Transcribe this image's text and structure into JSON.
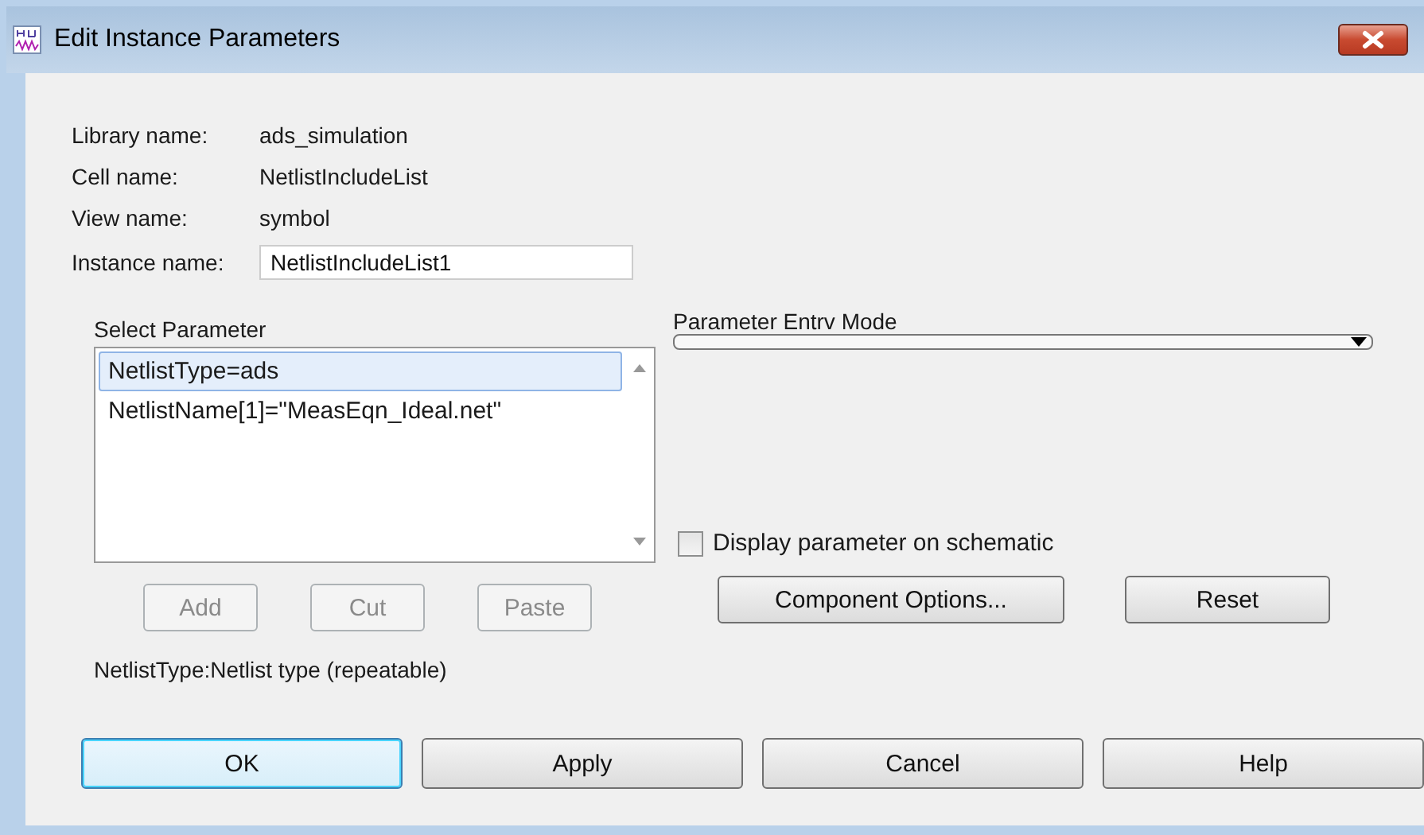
{
  "window": {
    "title": "Edit Instance Parameters"
  },
  "info": [
    {
      "label": "Library name:",
      "value": "ads_simulation"
    },
    {
      "label": "Cell name:",
      "value": "NetlistIncludeList"
    },
    {
      "label": "View name:",
      "value": "symbol"
    }
  ],
  "instance_name": {
    "label": "Instance name:",
    "value": "NetlistIncludeList1"
  },
  "select_parameter": {
    "label": "Select Parameter",
    "items": [
      {
        "text": "NetlistType=ads",
        "selected": true
      },
      {
        "text": "NetlistName[1]=\"MeasEqn_Ideal.net\"",
        "selected": false
      }
    ]
  },
  "list_buttons": [
    {
      "label": "Add",
      "disabled": true
    },
    {
      "label": "Cut",
      "disabled": true
    },
    {
      "label": "Paste",
      "disabled": true
    }
  ],
  "description": "NetlistType:Netlist type (repeatable)",
  "entry_mode": {
    "label": "Parameter Entrv Mode"
  },
  "display_on_schematic": {
    "label": "Display parameter on schematic",
    "checked": false
  },
  "option_buttons": [
    {
      "label": "Component Options..."
    },
    {
      "label": "Reset"
    }
  ],
  "buttons": [
    {
      "label": "OK",
      "default": true
    },
    {
      "label": "Apply",
      "default": false
    },
    {
      "label": "Cancel",
      "default": false
    },
    {
      "label": "Help",
      "default": false
    }
  ]
}
